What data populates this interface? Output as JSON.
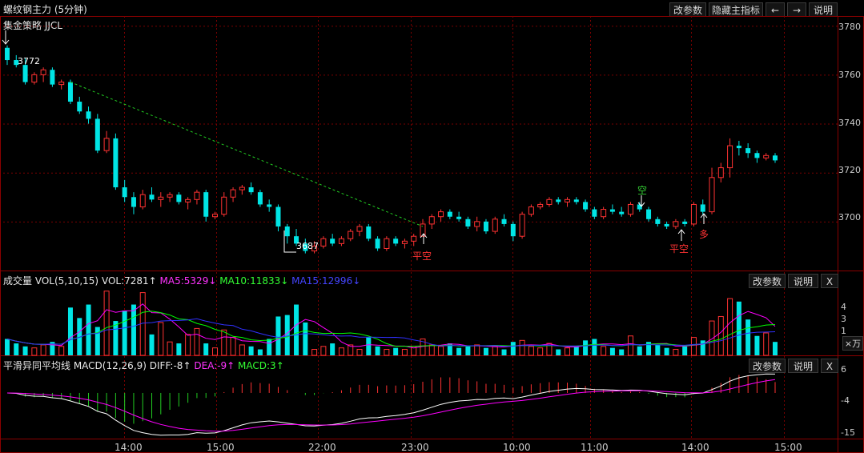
{
  "title": "螺纹钢主力 (5分钟)",
  "main_buttons": [
    "改参数",
    "隐藏主指标",
    "←",
    "→",
    "说明"
  ],
  "strategy_label": "集金策略 JJCL",
  "price_axis": [
    "3780",
    "3760",
    "3740",
    "3720",
    "3700"
  ],
  "marks": {
    "high": "3772",
    "low": "3687"
  },
  "signals": [
    {
      "text": "平空",
      "color": "#ff3333"
    },
    {
      "text": "空",
      "color": "#33cc33"
    },
    {
      "text": "平空",
      "color": "#ff3333"
    },
    {
      "text": "多",
      "color": "#ff3333"
    }
  ],
  "volume": {
    "label": "成交量 VOL(5,10,15)",
    "vol": "VOL:7281↑",
    "ma5": "MA5:5329↓",
    "ma10": "MA10:11833↓",
    "ma15": "MA15:12996↓",
    "axis": [
      "4",
      "3",
      "1"
    ],
    "unit": "×万",
    "buttons": [
      "改参数",
      "说明",
      "X"
    ]
  },
  "macd": {
    "label": "平滑异同平均线 MACD(12,26,9)",
    "diff": "DIFF:-8↑",
    "dea": "DEA:-9↑",
    "macd": "MACD:3↑",
    "axis": [
      "6",
      "-4",
      "-15"
    ],
    "buttons": [
      "改参数",
      "说明",
      "X"
    ]
  },
  "time_axis": [
    "14:00",
    "15:00",
    "22:00",
    "23:00",
    "10:00",
    "11:00",
    "14:00",
    "15:00"
  ],
  "colors": {
    "up": "#ff3232",
    "down": "#00e5e5",
    "grid": "#7a0000",
    "ma5": "#ff00ff",
    "ma10": "#00ff00",
    "ma15": "#3030ff"
  },
  "chart_data": {
    "type": "candlestick",
    "candles": [
      [
        3771,
        3772,
        3764,
        3766
      ],
      [
        3766,
        3768,
        3763,
        3764
      ],
      [
        3764,
        3767,
        3756,
        3757
      ],
      [
        3757,
        3761,
        3756,
        3760
      ],
      [
        3760,
        3763,
        3757,
        3762
      ],
      [
        3762,
        3763,
        3755,
        3756
      ],
      [
        3756,
        3758,
        3754,
        3757
      ],
      [
        3757,
        3758,
        3748,
        3749
      ],
      [
        3749,
        3751,
        3744,
        3745
      ],
      [
        3745,
        3747,
        3740,
        3742
      ],
      [
        3742,
        3744,
        3728,
        3729
      ],
      [
        3729,
        3737,
        3728,
        3734
      ],
      [
        3734,
        3736,
        3713,
        3714
      ],
      [
        3714,
        3717,
        3708,
        3710
      ],
      [
        3710,
        3712,
        3703,
        3706
      ],
      [
        3706,
        3713,
        3705,
        3711
      ],
      [
        3711,
        3714,
        3708,
        3709
      ],
      [
        3709,
        3712,
        3706,
        3710
      ],
      [
        3710,
        3712,
        3708,
        3711
      ],
      [
        3711,
        3712,
        3707,
        3708
      ],
      [
        3708,
        3710,
        3705,
        3709
      ],
      [
        3709,
        3713,
        3707,
        3712
      ],
      [
        3712,
        3713,
        3700,
        3702
      ],
      [
        3702,
        3704,
        3701,
        3703
      ],
      [
        3703,
        3712,
        3702,
        3710
      ],
      [
        3710,
        3714,
        3708,
        3713
      ],
      [
        3713,
        3715,
        3711,
        3714
      ],
      [
        3714,
        3716,
        3711,
        3712
      ],
      [
        3712,
        3713,
        3706,
        3707
      ],
      [
        3707,
        3709,
        3704,
        3706
      ],
      [
        3706,
        3707,
        3696,
        3698
      ],
      [
        3698,
        3699,
        3691,
        3694
      ],
      [
        3694,
        3697,
        3690,
        3691
      ],
      [
        3691,
        3693,
        3687,
        3688
      ],
      [
        3688,
        3692,
        3687,
        3690
      ],
      [
        3690,
        3694,
        3689,
        3693
      ],
      [
        3693,
        3695,
        3690,
        3691
      ],
      [
        3691,
        3694,
        3690,
        3693
      ],
      [
        3693,
        3697,
        3692,
        3696
      ],
      [
        3696,
        3699,
        3694,
        3698
      ],
      [
        3698,
        3699,
        3692,
        3693
      ],
      [
        3693,
        3694,
        3688,
        3689
      ],
      [
        3689,
        3694,
        3688,
        3693
      ],
      [
        3693,
        3694,
        3690,
        3691
      ],
      [
        3691,
        3693,
        3689,
        3692
      ],
      [
        3692,
        3695,
        3690,
        3694
      ],
      [
        3694,
        3701,
        3694,
        3699
      ],
      [
        3699,
        3703,
        3697,
        3702
      ],
      [
        3702,
        3705,
        3700,
        3704
      ],
      [
        3704,
        3705,
        3701,
        3702
      ],
      [
        3702,
        3704,
        3700,
        3701
      ],
      [
        3701,
        3702,
        3697,
        3698
      ],
      [
        3698,
        3702,
        3696,
        3700
      ],
      [
        3700,
        3701,
        3695,
        3696
      ],
      [
        3696,
        3702,
        3695,
        3701
      ],
      [
        3701,
        3703,
        3698,
        3699
      ],
      [
        3699,
        3700,
        3692,
        3694
      ],
      [
        3694,
        3704,
        3693,
        3703
      ],
      [
        3703,
        3707,
        3702,
        3706
      ],
      [
        3706,
        3708,
        3705,
        3707
      ],
      [
        3707,
        3710,
        3706,
        3709
      ],
      [
        3709,
        3710,
        3707,
        3708
      ],
      [
        3708,
        3710,
        3706,
        3709
      ],
      [
        3709,
        3710,
        3707,
        3708
      ],
      [
        3708,
        3709,
        3704,
        3705
      ],
      [
        3705,
        3706,
        3701,
        3702
      ],
      [
        3702,
        3706,
        3701,
        3705
      ],
      [
        3705,
        3707,
        3703,
        3704
      ],
      [
        3704,
        3706,
        3702,
        3703
      ],
      [
        3703,
        3708,
        3702,
        3707
      ],
      [
        3707,
        3708,
        3704,
        3705
      ],
      [
        3705,
        3706,
        3700,
        3701
      ],
      [
        3701,
        3702,
        3698,
        3699
      ],
      [
        3699,
        3700,
        3697,
        3698
      ],
      [
        3698,
        3701,
        3697,
        3700
      ],
      [
        3700,
        3701,
        3698,
        3699
      ],
      [
        3699,
        3708,
        3698,
        3707
      ],
      [
        3707,
        3709,
        3703,
        3704
      ],
      [
        3704,
        3722,
        3703,
        3718
      ],
      [
        3718,
        3724,
        3716,
        3722
      ],
      [
        3722,
        3734,
        3718,
        3731
      ],
      [
        3731,
        3733,
        3727,
        3730
      ],
      [
        3730,
        3732,
        3726,
        3728
      ],
      [
        3728,
        3729,
        3724,
        3726
      ],
      [
        3726,
        3728,
        3725,
        3727
      ],
      [
        3727,
        3728,
        3724,
        3725
      ]
    ],
    "volumes": [
      1.1,
      0.8,
      0.6,
      0.5,
      0.7,
      0.9,
      0.6,
      3.2,
      2.5,
      3.4,
      1.9,
      4.3,
      2.3,
      3.0,
      3.4,
      4.2,
      1.4,
      2.2,
      0.9,
      0.8,
      1.4,
      1.8,
      0.8,
      0.5,
      1.7,
      1.2,
      0.7,
      0.6,
      0.4,
      1.1,
      2.6,
      2.7,
      3.4,
      2.2,
      0.4,
      0.6,
      0.8,
      0.5,
      0.7,
      0.4,
      1.2,
      0.6,
      0.4,
      0.5,
      0.4,
      0.6,
      1.1,
      0.7,
      0.6,
      0.8,
      0.5,
      0.6,
      0.7,
      0.5,
      0.6,
      0.4,
      0.9,
      1.0,
      0.6,
      0.5,
      0.8,
      0.4,
      0.5,
      0.6,
      1.0,
      1.1,
      0.6,
      0.5,
      0.4,
      1.3,
      0.6,
      0.9,
      0.7,
      0.5,
      0.4,
      0.6,
      1.2,
      1.0,
      2.3,
      2.6,
      3.8,
      3.6,
      2.4,
      1.3,
      1.5,
      0.9
    ],
    "price_range": [
      3680,
      3784
    ],
    "volume_range": [
      0,
      4.5
    ],
    "macd_range": [
      -16,
      7
    ]
  }
}
